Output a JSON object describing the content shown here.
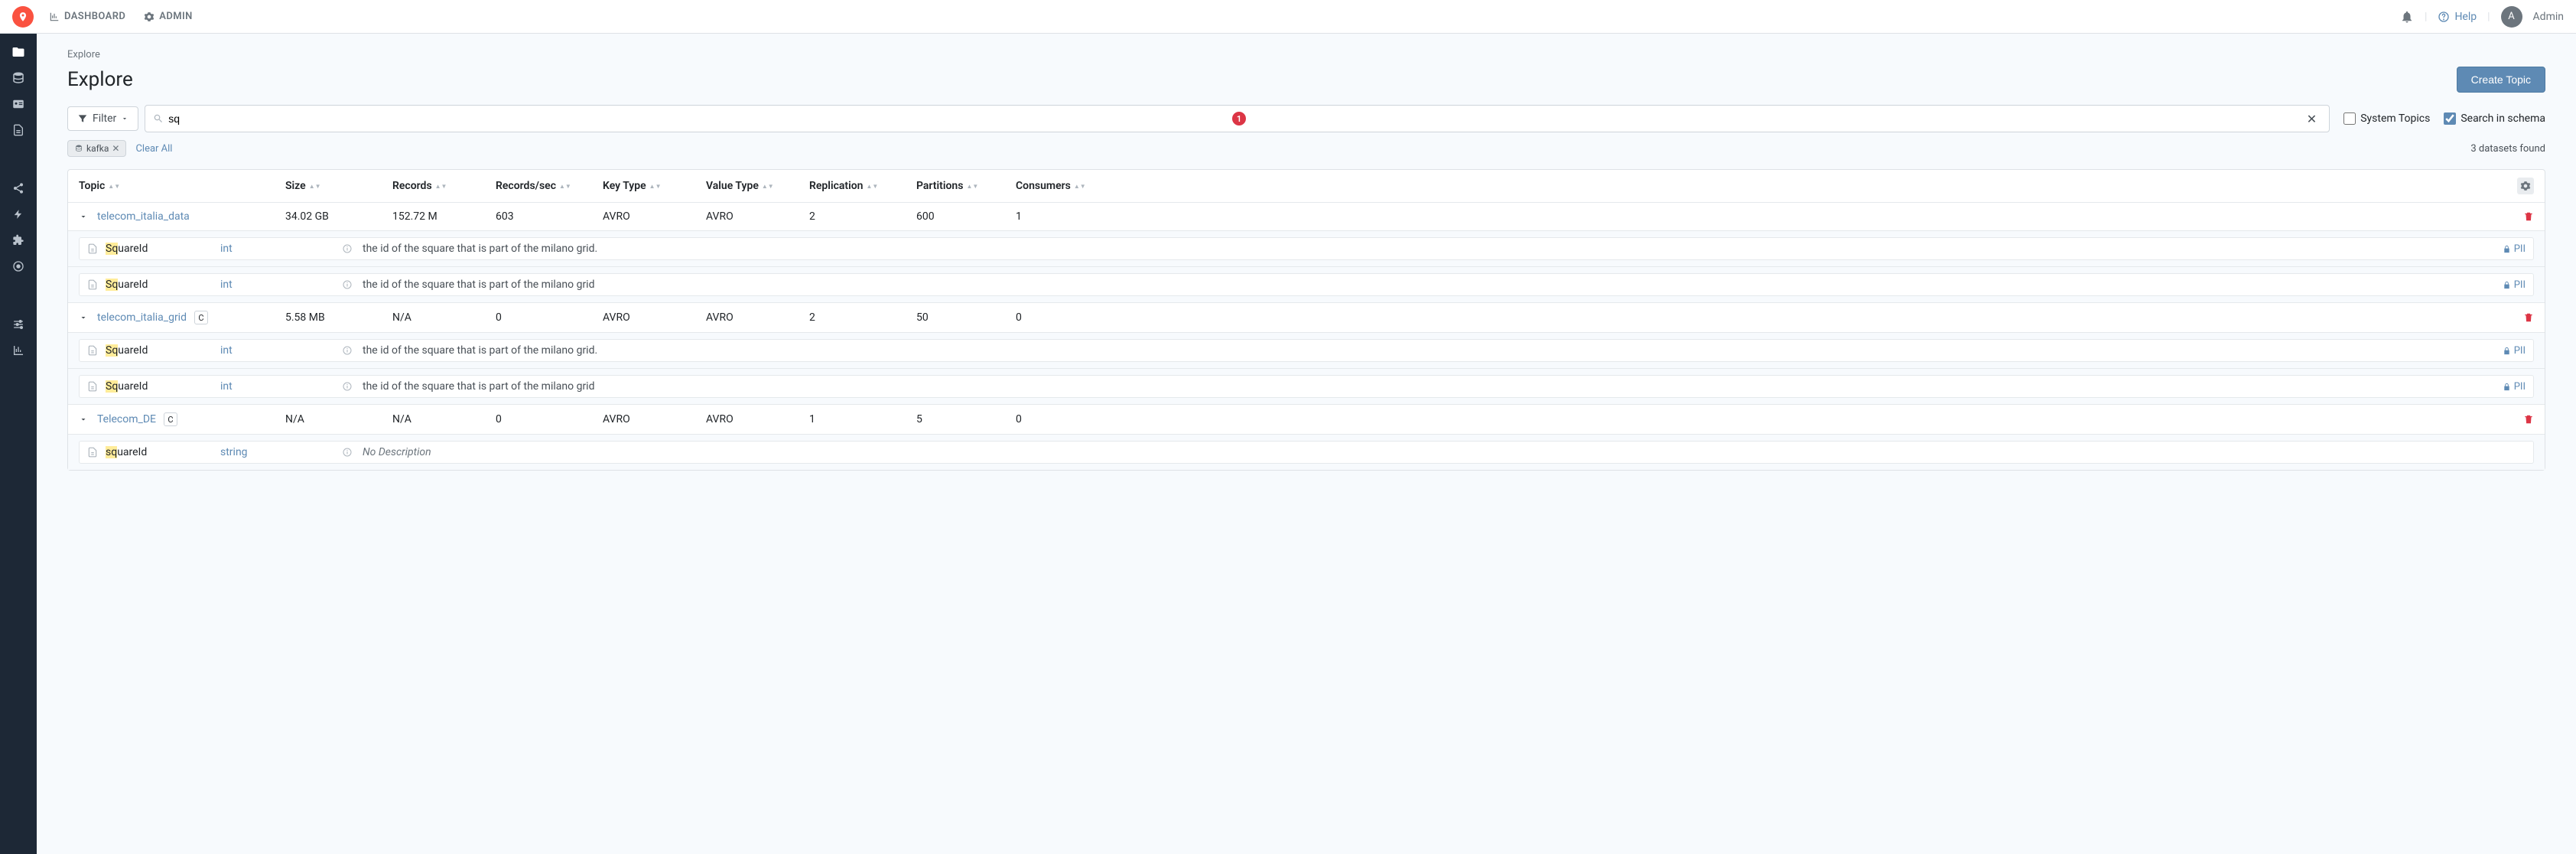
{
  "nav": {
    "dashboard": "DASHBOARD",
    "admin": "ADMIN"
  },
  "topbar": {
    "help": "Help",
    "avatar_letter": "A",
    "user": "Admin"
  },
  "breadcrumb": "Explore",
  "page_title": "Explore",
  "create_button": "Create Topic",
  "filter": {
    "button": "Filter"
  },
  "search": {
    "value": "sq",
    "count": "1"
  },
  "options": {
    "system_topics": "System Topics",
    "search_in_schema": "Search in schema"
  },
  "chips": {
    "kafka": "kafka"
  },
  "clear_all": "Clear All",
  "found_text": "3 datasets found",
  "columns": {
    "topic": "Topic",
    "size": "Size",
    "records": "Records",
    "recsec": "Records/sec",
    "keytype": "Key Type",
    "valtype": "Value Type",
    "replication": "Replication",
    "partitions": "Partitions",
    "consumers": "Consumers"
  },
  "topics": [
    {
      "name": "telecom_italia_data",
      "badge": "",
      "size": "34.02 GB",
      "records": "152.72 M",
      "recsec": "603",
      "keytype": "AVRO",
      "valtype": "AVRO",
      "replication": "2",
      "partitions": "600",
      "consumers": "1",
      "fields": [
        {
          "hl": "Sq",
          "rest": "uareId",
          "type": "int",
          "desc": "the id of the square that is part of the milano grid.",
          "pii": true
        },
        {
          "hl": "Sq",
          "rest": "uareId",
          "type": "int",
          "desc": "the id of the square that is part of the milano grid",
          "pii": true
        }
      ]
    },
    {
      "name": "telecom_italia_grid",
      "badge": "C",
      "size": "5.58 MB",
      "records": "N/A",
      "recsec": "0",
      "keytype": "AVRO",
      "valtype": "AVRO",
      "replication": "2",
      "partitions": "50",
      "consumers": "0",
      "fields": [
        {
          "hl": "Sq",
          "rest": "uareId",
          "type": "int",
          "desc": "the id of the square that is part of the milano grid.",
          "pii": true
        },
        {
          "hl": "Sq",
          "rest": "uareId",
          "type": "int",
          "desc": "the id of the square that is part of the milano grid",
          "pii": true
        }
      ]
    },
    {
      "name": "Telecom_DE",
      "badge": "C",
      "size": "N/A",
      "records": "N/A",
      "recsec": "0",
      "keytype": "AVRO",
      "valtype": "AVRO",
      "replication": "1",
      "partitions": "5",
      "consumers": "0",
      "fields": [
        {
          "hl": "sq",
          "rest": "uareId",
          "type": "string",
          "desc": "No Description",
          "pii": false,
          "nodesc": true
        }
      ]
    }
  ],
  "pii_label": "PII"
}
